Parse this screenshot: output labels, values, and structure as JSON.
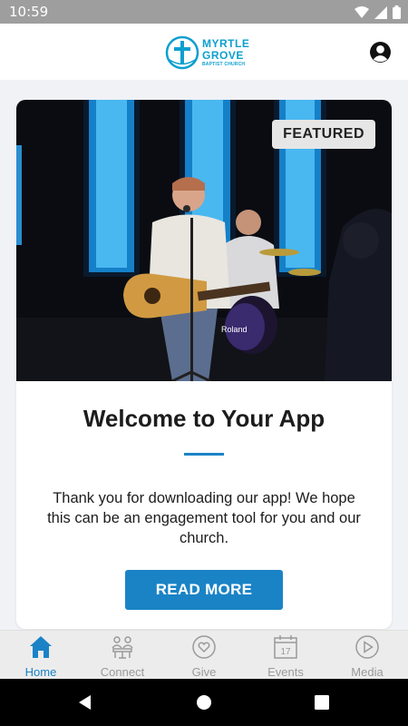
{
  "status_bar": {
    "time": "10:59"
  },
  "header": {
    "logo": {
      "line1": "MYRTLE",
      "line2": "GROVE",
      "line3": "BAPTIST CHURCH"
    },
    "accent": "#0d9fcf"
  },
  "featured_card": {
    "badge": "FEATURED",
    "title": "Welcome to Your App",
    "body": "Thank you for downloading our app! We hope this can be an engagement tool for you and our church.",
    "button": "READ MORE",
    "photo_signage": "Roland"
  },
  "tabs": [
    {
      "label": "Home",
      "icon": "home-icon",
      "active": true
    },
    {
      "label": "Connect",
      "icon": "connect-icon",
      "active": false
    },
    {
      "label": "Give",
      "icon": "heart-icon",
      "active": false
    },
    {
      "label": "Events",
      "icon": "calendar-icon",
      "active": false,
      "icon_text": "17"
    },
    {
      "label": "Media",
      "icon": "play-icon",
      "active": false
    }
  ],
  "colors": {
    "primary": "#1a83c6",
    "inactive": "#9a9a9a",
    "background": "#f1f2f6"
  }
}
